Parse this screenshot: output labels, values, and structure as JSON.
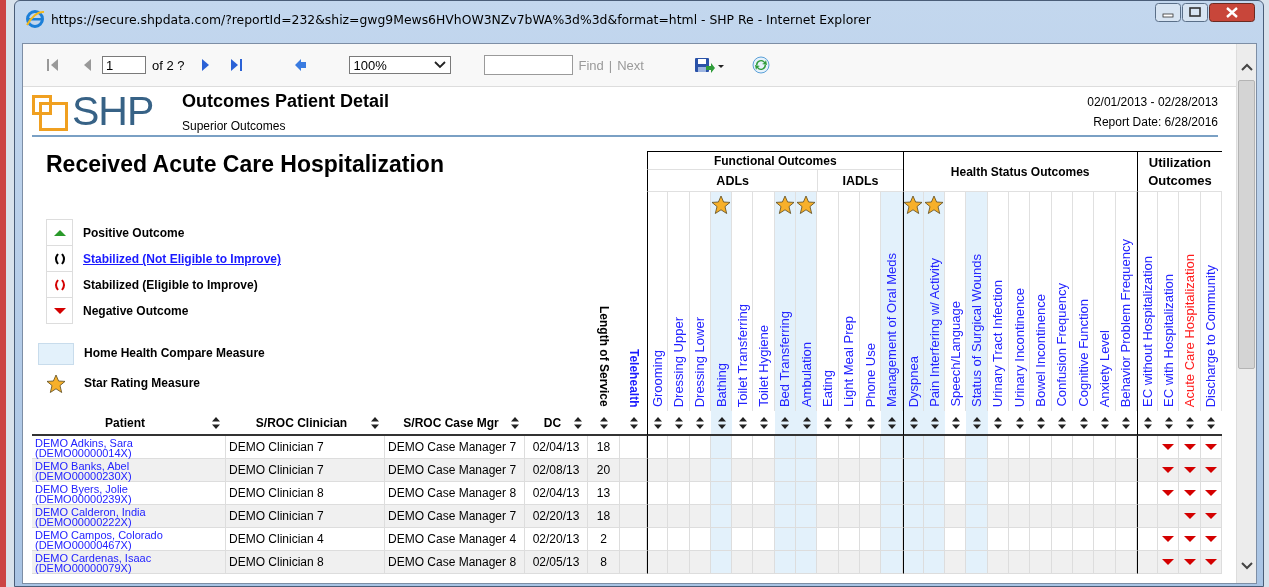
{
  "window": {
    "title": "https://secure.shpdata.com/?reportId=232&shiz=gwg9Mews6HVhOW3NZv7bWA%3d%3d&format=html - SHP Re - Internet Explorer"
  },
  "toolbar": {
    "page": "1",
    "page_count": "of 2 ?",
    "zoom": "100%",
    "find": "Find",
    "separator": "|",
    "next": "Next"
  },
  "report": {
    "logo": "SHP",
    "title": "Outcomes Patient Detail",
    "subtitle": "Superior Outcomes",
    "date_range": "02/01/2013 - 02/28/2013",
    "report_date": "Report Date: 6/28/2016",
    "measure_title": "Received Acute Care Hospitalization"
  },
  "legend": [
    {
      "kind": "positive",
      "label": "Positive Outcome",
      "link": false
    },
    {
      "kind": "stable_not_eligible",
      "label": "Stabilized (Not Eligible to Improve)",
      "link": true
    },
    {
      "kind": "stable_eligible",
      "label": "Stabilized (Eligible to Improve)",
      "link": false
    },
    {
      "kind": "negative",
      "label": "Negative Outcome",
      "link": false
    },
    {
      "kind": "hhc",
      "label": "Home Health Compare Measure",
      "link": false
    },
    {
      "kind": "star",
      "label": "Star Rating Measure",
      "link": false
    }
  ],
  "columns": [
    {
      "label": "Patient"
    },
    {
      "label": "S/ROC Clinician"
    },
    {
      "label": "S/ROC Case Mgr"
    },
    {
      "label": "DC"
    },
    {
      "label": "Length of Service"
    },
    {
      "label": "Telehealth"
    }
  ],
  "outcome_groups": [
    {
      "title": "Functional Outcomes",
      "subgroups": [
        {
          "title": "ADLs",
          "measures": [
            {
              "label": "Grooming",
              "hhc": false,
              "star": false,
              "selected": false
            },
            {
              "label": "Dressing Upper",
              "hhc": false,
              "star": false,
              "selected": false
            },
            {
              "label": "Dressing Lower",
              "hhc": false,
              "star": false,
              "selected": false
            },
            {
              "label": "Bathing",
              "hhc": true,
              "star": true,
              "selected": false
            },
            {
              "label": "Toilet Transferring",
              "hhc": false,
              "star": false,
              "selected": false
            },
            {
              "label": "Toilet Hygiene",
              "hhc": false,
              "star": false,
              "selected": false
            },
            {
              "label": "Bed Transferring",
              "hhc": true,
              "star": true,
              "selected": false
            },
            {
              "label": "Ambulation",
              "hhc": true,
              "star": true,
              "selected": false
            }
          ]
        },
        {
          "title": "IADLs",
          "measures": [
            {
              "label": "Eating",
              "hhc": false,
              "star": false,
              "selected": false
            },
            {
              "label": "Light Meal Prep",
              "hhc": false,
              "star": false,
              "selected": false
            },
            {
              "label": "Phone Use",
              "hhc": false,
              "star": false,
              "selected": false
            },
            {
              "label": "Management of Oral Meds",
              "hhc": true,
              "star": false,
              "selected": false
            }
          ]
        }
      ]
    },
    {
      "title": "Health Status Outcomes",
      "measures": [
        {
          "label": "Dyspnea",
          "hhc": true,
          "star": true,
          "selected": false
        },
        {
          "label": "Pain Interfering w/ Activity",
          "hhc": true,
          "star": true,
          "selected": false
        },
        {
          "label": "Speech/Language",
          "hhc": false,
          "star": false,
          "selected": false
        },
        {
          "label": "Status of Surgical Wounds",
          "hhc": true,
          "star": false,
          "selected": false
        },
        {
          "label": "Urinary Tract Infection",
          "hhc": false,
          "star": false,
          "selected": false
        },
        {
          "label": "Urinary Incontinence",
          "hhc": false,
          "star": false,
          "selected": false
        },
        {
          "label": "Bowel Incontinence",
          "hhc": false,
          "star": false,
          "selected": false
        },
        {
          "label": "Confusion Frequency",
          "hhc": false,
          "star": false,
          "selected": false
        },
        {
          "label": "Cognitive Function",
          "hhc": false,
          "star": false,
          "selected": false
        },
        {
          "label": "Anxiety Level",
          "hhc": false,
          "star": false,
          "selected": false
        },
        {
          "label": "Behavior Problem Frequency",
          "hhc": false,
          "star": false,
          "selected": false
        }
      ]
    },
    {
      "title": "Utilization Outcomes",
      "measures": [
        {
          "label": "EC without Hospitalization",
          "hhc": false,
          "star": false,
          "selected": false
        },
        {
          "label": "EC with Hospitalization",
          "hhc": false,
          "star": false,
          "selected": false
        },
        {
          "label": "Acute Care Hospitalization",
          "hhc": false,
          "star": false,
          "selected": true
        },
        {
          "label": "Discharge to Community",
          "hhc": false,
          "star": false,
          "selected": false
        }
      ]
    }
  ],
  "rows": [
    {
      "patient": "DEMO Adkins, Sara",
      "patient_id": "(DEMO00000014X)",
      "clinician": "DEMO Clinician 7",
      "case_mgr": "DEMO Case Manager 7",
      "dc": "02/04/13",
      "length": "18",
      "outcomes": [
        {
          "negative": false
        },
        {
          "negative": false
        },
        {
          "negative": false
        },
        {
          "negative": false
        },
        {
          "negative": false
        },
        {
          "negative": false
        },
        {
          "negative": false
        },
        {
          "negative": false
        },
        {
          "negative": false
        },
        {
          "negative": false
        },
        {
          "negative": false
        },
        {
          "negative": false
        },
        {
          "negative": false
        },
        {
          "negative": false
        },
        {
          "negative": false
        },
        {
          "negative": false
        },
        {
          "negative": false
        },
        {
          "negative": false
        },
        {
          "negative": false
        },
        {
          "negative": false
        },
        {
          "negative": false
        },
        {
          "negative": false
        },
        {
          "negative": false
        },
        {
          "negative": false
        },
        {
          "negative": true
        },
        {
          "negative": true
        },
        {
          "negative": true
        }
      ]
    },
    {
      "patient": "DEMO Banks, Abel",
      "patient_id": "(DEMO00000230X)",
      "clinician": "DEMO Clinician 7",
      "case_mgr": "DEMO Case Manager 7",
      "dc": "02/08/13",
      "length": "20",
      "outcomes": [
        {
          "negative": false
        },
        {
          "negative": false
        },
        {
          "negative": false
        },
        {
          "negative": false
        },
        {
          "negative": false
        },
        {
          "negative": false
        },
        {
          "negative": false
        },
        {
          "negative": false
        },
        {
          "negative": false
        },
        {
          "negative": false
        },
        {
          "negative": false
        },
        {
          "negative": false
        },
        {
          "negative": false
        },
        {
          "negative": false
        },
        {
          "negative": false
        },
        {
          "negative": false
        },
        {
          "negative": false
        },
        {
          "negative": false
        },
        {
          "negative": false
        },
        {
          "negative": false
        },
        {
          "negative": false
        },
        {
          "negative": false
        },
        {
          "negative": false
        },
        {
          "negative": false
        },
        {
          "negative": true
        },
        {
          "negative": true
        },
        {
          "negative": true
        }
      ]
    },
    {
      "patient": "DEMO Byers, Jolie",
      "patient_id": "(DEMO00000239X)",
      "clinician": "DEMO Clinician 8",
      "case_mgr": "DEMO Case Manager 8",
      "dc": "02/04/13",
      "length": "13",
      "outcomes": [
        {
          "negative": false
        },
        {
          "negative": false
        },
        {
          "negative": false
        },
        {
          "negative": false
        },
        {
          "negative": false
        },
        {
          "negative": false
        },
        {
          "negative": false
        },
        {
          "negative": false
        },
        {
          "negative": false
        },
        {
          "negative": false
        },
        {
          "negative": false
        },
        {
          "negative": false
        },
        {
          "negative": false
        },
        {
          "negative": false
        },
        {
          "negative": false
        },
        {
          "negative": false
        },
        {
          "negative": false
        },
        {
          "negative": false
        },
        {
          "negative": false
        },
        {
          "negative": false
        },
        {
          "negative": false
        },
        {
          "negative": false
        },
        {
          "negative": false
        },
        {
          "negative": false
        },
        {
          "negative": true
        },
        {
          "negative": true
        },
        {
          "negative": true
        }
      ]
    },
    {
      "patient": "DEMO Calderon, India",
      "patient_id": "(DEMO00000222X)",
      "clinician": "DEMO Clinician 7",
      "case_mgr": "DEMO Case Manager 7",
      "dc": "02/20/13",
      "length": "18",
      "outcomes": [
        {
          "negative": false
        },
        {
          "negative": false
        },
        {
          "negative": false
        },
        {
          "negative": false
        },
        {
          "negative": false
        },
        {
          "negative": false
        },
        {
          "negative": false
        },
        {
          "negative": false
        },
        {
          "negative": false
        },
        {
          "negative": false
        },
        {
          "negative": false
        },
        {
          "negative": false
        },
        {
          "negative": false
        },
        {
          "negative": false
        },
        {
          "negative": false
        },
        {
          "negative": false
        },
        {
          "negative": false
        },
        {
          "negative": false
        },
        {
          "negative": false
        },
        {
          "negative": false
        },
        {
          "negative": false
        },
        {
          "negative": false
        },
        {
          "negative": false
        },
        {
          "negative": false
        },
        {
          "negative": false
        },
        {
          "negative": true
        },
        {
          "negative": true
        }
      ]
    },
    {
      "patient": "DEMO Campos, Colorado",
      "patient_id": "(DEMO00000467X)",
      "clinician": "DEMO Clinician 4",
      "case_mgr": "DEMO Case Manager 4",
      "dc": "02/20/13",
      "length": "2",
      "outcomes": [
        {
          "negative": false
        },
        {
          "negative": false
        },
        {
          "negative": false
        },
        {
          "negative": false
        },
        {
          "negative": false
        },
        {
          "negative": false
        },
        {
          "negative": false
        },
        {
          "negative": false
        },
        {
          "negative": false
        },
        {
          "negative": false
        },
        {
          "negative": false
        },
        {
          "negative": false
        },
        {
          "negative": false
        },
        {
          "negative": false
        },
        {
          "negative": false
        },
        {
          "negative": false
        },
        {
          "negative": false
        },
        {
          "negative": false
        },
        {
          "negative": false
        },
        {
          "negative": false
        },
        {
          "negative": false
        },
        {
          "negative": false
        },
        {
          "negative": false
        },
        {
          "negative": false
        },
        {
          "negative": true
        },
        {
          "negative": true
        },
        {
          "negative": true
        }
      ]
    },
    {
      "patient": "DEMO Cardenas, Isaac",
      "patient_id": "(DEMO00000079X)",
      "clinician": "DEMO Clinician 8",
      "case_mgr": "DEMO Case Manager 8",
      "dc": "02/05/13",
      "length": "8",
      "outcomes": [
        {
          "negative": false
        },
        {
          "negative": false
        },
        {
          "negative": false
        },
        {
          "negative": false
        },
        {
          "negative": false
        },
        {
          "negative": false
        },
        {
          "negative": false
        },
        {
          "negative": false
        },
        {
          "negative": false
        },
        {
          "negative": false
        },
        {
          "negative": false
        },
        {
          "negative": false
        },
        {
          "negative": false
        },
        {
          "negative": false
        },
        {
          "negative": false
        },
        {
          "negative": false
        },
        {
          "negative": false
        },
        {
          "negative": false
        },
        {
          "negative": false
        },
        {
          "negative": false
        },
        {
          "negative": false
        },
        {
          "negative": false
        },
        {
          "negative": false
        },
        {
          "negative": false
        },
        {
          "negative": true
        },
        {
          "negative": true
        },
        {
          "negative": true
        }
      ]
    }
  ]
}
